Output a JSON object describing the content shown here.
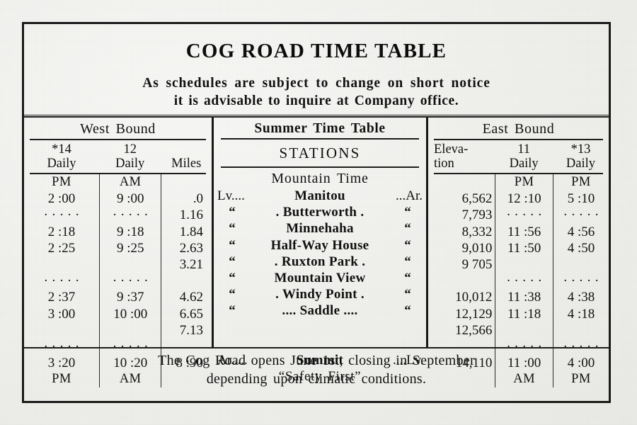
{
  "document": {
    "title": "COG ROAD TIME TABLE",
    "notice_line_1": "As schedules are subject to change on short notice",
    "notice_line_2": "it is advisable to inquire at Company office.",
    "footer_line_1": "The Cog Road opens June 1st, closing in September",
    "footer_line_2": "depending upon climatic conditions.",
    "ink_color": "#1a1a1a",
    "paper_color": "#efefec"
  },
  "westbound": {
    "heading": "West Bound",
    "columns": [
      {
        "train": "*14",
        "frequency": "Daily"
      },
      {
        "train": "12",
        "frequency": "Daily"
      },
      {
        "label": "Miles"
      }
    ],
    "meridiem_top": [
      "PM",
      "AM",
      ""
    ],
    "meridiem_bottom": [
      "PM",
      "AM",
      ""
    ]
  },
  "center": {
    "heading": "Summer Time Table",
    "stations_label": "STATIONS",
    "time_zone": "Mountain Time",
    "motto": "“Safety First”"
  },
  "eastbound": {
    "heading": "East Bound",
    "columns": [
      {
        "label_line_1": "Eleva-",
        "label_line_2": "tion"
      },
      {
        "train": "11",
        "frequency": "Daily"
      },
      {
        "train": "*13",
        "frequency": "Daily"
      }
    ],
    "meridiem_top": [
      "",
      "PM",
      "PM"
    ],
    "meridiem_bottom": [
      "",
      "AM",
      "PM"
    ]
  },
  "dots": "· · · · ·",
  "rows": [
    {
      "wb_14": "2 :00",
      "wb_12": "9 :00",
      "miles": ".0",
      "prefix": "Lv....",
      "station": "Manitou",
      "suffix": "...Ar.",
      "elevation": "6,562",
      "eb_11": "12 :10",
      "eb_13": "5 :10"
    },
    {
      "wb_14": "· · · · ·",
      "wb_12": "· · · · ·",
      "miles": "1.16",
      "prefix": "“",
      "station": ". Butterworth .",
      "suffix": "“",
      "elevation": "7,793",
      "eb_11": "· · · · ·",
      "eb_13": "· · · · ·"
    },
    {
      "wb_14": "2 :18",
      "wb_12": "9 :18",
      "miles": "1.84",
      "prefix": "“",
      "station": "Minnehaha",
      "suffix": "“",
      "elevation": "8,332",
      "eb_11": "11 :56",
      "eb_13": "4 :56"
    },
    {
      "wb_14": "2 :25",
      "wb_12": "9 :25",
      "miles": "2.63",
      "prefix": "“",
      "station": "Half-Way House",
      "suffix": "“",
      "elevation": "9,010",
      "eb_11": "11 :50",
      "eb_13": "4 :50"
    },
    {
      "wb_14": "",
      "wb_12": "",
      "miles": "3.21",
      "prefix": "“",
      "station": ". Ruxton Park .",
      "suffix": "“",
      "elevation": "9 705",
      "eb_11": "",
      "eb_13": ""
    },
    {
      "wb_14": "· · · · ·",
      "wb_12": "· · · · ·",
      "miles": "",
      "prefix": "“",
      "station": "Mountain View",
      "suffix": "“",
      "elevation": "",
      "eb_11": "· · · · ·",
      "eb_13": "· · · · ·"
    },
    {
      "wb_14": "2 :37",
      "wb_12": "9 :37",
      "miles": "4.62",
      "prefix": "“",
      "station": ". Windy Point .",
      "suffix": "“",
      "elevation": "10,012",
      "eb_11": "11 :38",
      "eb_13": "4 :38"
    },
    {
      "wb_14": "3 :00",
      "wb_12": "10 :00",
      "miles": "6.65",
      "prefix": "“",
      "station": ".... Saddle ....",
      "suffix": "“",
      "elevation": "12,129",
      "eb_11": "11 :18",
      "eb_13": "4 :18"
    },
    {
      "wb_14": "",
      "wb_12": "",
      "miles": "7.13",
      "prefix": "",
      "station": "",
      "suffix": "",
      "elevation": "12,566",
      "eb_11": "",
      "eb_13": ""
    },
    {
      "wb_14": "· · · · ·",
      "wb_12": "· · · · ·",
      "miles": "",
      "prefix": "",
      "station": "",
      "suffix": "",
      "elevation": "",
      "eb_11": "· · · · ·",
      "eb_13": "· · · · ·"
    },
    {
      "wb_14": "3 :20",
      "wb_12": "10 :20",
      "miles": "8 :90",
      "prefix": "Ar.....",
      "station": "Summit",
      "suffix": "....Lv.",
      "elevation": "14,110",
      "eb_11": "11 :00",
      "eb_13": "4 :00"
    }
  ],
  "station_sequence": [
    {
      "name": "Manitou",
      "miles": ".0",
      "elevation": "6,562"
    },
    {
      "name": "Butterworth",
      "miles": "1.16",
      "elevation": "7,793"
    },
    {
      "name": "Minnehaha",
      "miles": "1.84",
      "elevation": "8,332"
    },
    {
      "name": "Half-Way House",
      "miles": "2.63",
      "elevation": "9,010"
    },
    {
      "name": "Ruxton Park",
      "miles": "3.21",
      "elevation": "9 705"
    },
    {
      "name": "Mountain View",
      "miles": "4.62",
      "elevation": "10,012"
    },
    {
      "name": "Windy Point",
      "miles": "6.65",
      "elevation": "12,129"
    },
    {
      "name": "Saddle",
      "miles": "7.13",
      "elevation": "12,566"
    },
    {
      "name": "Summit",
      "miles": "8 :90",
      "elevation": "14,110"
    }
  ]
}
